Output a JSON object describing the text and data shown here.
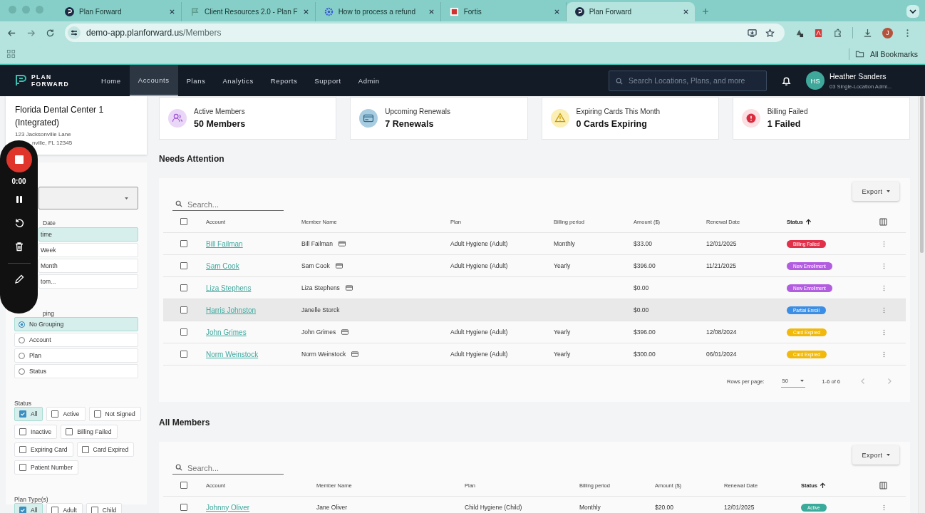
{
  "browser": {
    "tabs": [
      {
        "title": "Plan Forward",
        "kind": "planforward",
        "selected": false
      },
      {
        "title": "Client Resources 2.0 - Plan F",
        "kind": "flag",
        "selected": false
      },
      {
        "title": "How to process a refund",
        "kind": "gear",
        "selected": false
      },
      {
        "title": "Fortis",
        "kind": "fortis",
        "selected": false
      },
      {
        "title": "Plan Forward",
        "kind": "planforward",
        "selected": true
      }
    ],
    "url_host": "demo-app.planforward.us",
    "url_path": "/Members",
    "profile_initial": "J",
    "bookmarks_label": "All Bookmarks"
  },
  "app": {
    "logo_lines": [
      "PLAN",
      "FORWARD"
    ],
    "nav": [
      {
        "label": "Home",
        "selected": false
      },
      {
        "label": "Accounts",
        "selected": true
      },
      {
        "label": "Plans",
        "selected": false
      },
      {
        "label": "Analytics",
        "selected": false
      },
      {
        "label": "Reports",
        "selected": false
      },
      {
        "label": "Support",
        "selected": false
      },
      {
        "label": "Admin",
        "selected": false
      }
    ],
    "search": {
      "placeholder": "Search Locations, Plans, and more"
    },
    "user": {
      "initials": "HS",
      "name": "Heather Sanders",
      "role": "03 Single-Location Admi..."
    }
  },
  "location": {
    "name": "Florida Dental Center 1 (Integrated)",
    "address_1": "123 Jacksonville Lane",
    "address_2": "nville, FL 12345"
  },
  "recorder": {
    "time": "0:00"
  },
  "filters": {
    "date_label": "Date",
    "date_options": [
      {
        "label": "time",
        "selected": true
      },
      {
        "label": "Week",
        "selected": false
      },
      {
        "label": "Month",
        "selected": false
      },
      {
        "label": "tom...",
        "selected": false
      }
    ],
    "grouping_label": "ping",
    "grouping_options": [
      {
        "label": "No Grouping",
        "selected": true
      },
      {
        "label": "Account",
        "selected": false
      },
      {
        "label": "Plan",
        "selected": false
      },
      {
        "label": "Status",
        "selected": false
      }
    ],
    "status_label": "Status",
    "status_chips": [
      {
        "label": "All",
        "checked": true
      },
      {
        "label": "Active",
        "checked": false
      },
      {
        "label": "Not Signed",
        "checked": false
      },
      {
        "label": "Inactive",
        "checked": false
      },
      {
        "label": "Billing Failed",
        "checked": false
      },
      {
        "label": "Expiring Card",
        "checked": false
      },
      {
        "label": "Card Expired",
        "checked": false
      },
      {
        "label": "Patient Number",
        "checked": false
      }
    ],
    "plan_type_label": "Plan Type(s)",
    "plan_type_chips": [
      {
        "label": "All",
        "checked": true
      },
      {
        "label": "Adult",
        "checked": false
      },
      {
        "label": "Child",
        "checked": false
      }
    ]
  },
  "stats": [
    {
      "kind": "members",
      "label": "Active Members",
      "value": "50 Members"
    },
    {
      "kind": "renewals",
      "label": "Upcoming Renewals",
      "value": "7 Renewals"
    },
    {
      "kind": "warning",
      "label": "Expiring Cards This Month",
      "value": "0 Cards Expiring"
    },
    {
      "kind": "error",
      "label": "Billing Failed",
      "value": "1 Failed"
    }
  ],
  "sections": [
    {
      "title": "Needs Attention",
      "search": {
        "placeholder": "Search..."
      },
      "export": "Export",
      "all_checked": false,
      "columns": [
        {
          "label": "Account",
          "sorted": false
        },
        {
          "label": "Member Name",
          "sorted": false
        },
        {
          "label": "Plan",
          "sorted": false
        },
        {
          "label": "Billing period",
          "sorted": false
        },
        {
          "label": "Amount ($)",
          "sorted": false
        },
        {
          "label": "Renewal Date",
          "sorted": false
        },
        {
          "label": "Status",
          "sorted": true
        }
      ],
      "rows": [
        {
          "account": "Bill Failman",
          "member": "Bill Failman",
          "card_on_file": true,
          "plan": "Adult Hygiene (Adult)",
          "billing": "Monthly",
          "amount": "$33.00",
          "renewal": "12/01/2025",
          "status": "Billing Failed",
          "color": "#e0304a",
          "checked": false,
          "highlighted": false
        },
        {
          "account": "Sam Cook",
          "member": "Sam Cook",
          "card_on_file": true,
          "plan": "Adult Hygiene (Adult)",
          "billing": "Yearly",
          "amount": "$396.00",
          "renewal": "11/21/2025",
          "status": "New Enrollment",
          "color": "#b25ce0",
          "checked": false,
          "highlighted": false
        },
        {
          "account": "Liza Stephens",
          "member": "Liza Stephens",
          "card_on_file": true,
          "plan": "",
          "billing": "",
          "amount": "$0.00",
          "renewal": "",
          "status": "New Enrollment",
          "color": "#b25ce0",
          "checked": false,
          "highlighted": false
        },
        {
          "account": "Harris Johnston",
          "member": "Janelle Storck",
          "card_on_file": false,
          "plan": "",
          "billing": "",
          "amount": "$0.00",
          "renewal": "",
          "status": "Partial Enroll",
          "color": "#3a8ee6",
          "checked": false,
          "highlighted": true
        },
        {
          "account": "John Grimes",
          "member": "John Grimes",
          "card_on_file": true,
          "plan": "Adult Hygiene (Adult)",
          "billing": "Yearly",
          "amount": "$396.00",
          "renewal": "12/08/2024",
          "status": "Card Expired",
          "color": "#f0b90b",
          "checked": false,
          "highlighted": false
        },
        {
          "account": "Norm Weinstock",
          "member": "Norm Weinstock",
          "card_on_file": true,
          "plan": "Adult Hygiene (Adult)",
          "billing": "Yearly",
          "amount": "$300.00",
          "renewal": "06/01/2024",
          "status": "Card Expired",
          "color": "#f0b90b",
          "checked": false,
          "highlighted": false
        }
      ],
      "pagination": {
        "rows_per_page_label": "Rows per page:",
        "rows_per_page": "50",
        "range": "1-6 of 6"
      }
    },
    {
      "title": "All Members",
      "search": {
        "placeholder": "Search..."
      },
      "export": "Export",
      "all_checked": false,
      "columns": [
        {
          "label": "Account",
          "sorted": false
        },
        {
          "label": "Member Name",
          "sorted": false
        },
        {
          "label": "Plan",
          "sorted": false
        },
        {
          "label": "Billing period",
          "sorted": false
        },
        {
          "label": "Amount ($)",
          "sorted": false
        },
        {
          "label": "Renewal Date",
          "sorted": false
        },
        {
          "label": "Status",
          "sorted": true
        }
      ],
      "rows": [
        {
          "account": "Johnny Oliver",
          "member": "Jane Oliver",
          "card_on_file": false,
          "plan": "Child Hygiene (Child)",
          "billing": "Monthly",
          "amount": "$20.00",
          "renewal": "12/01/2025",
          "status": "Active",
          "color": "#3aaa9a",
          "checked": false,
          "highlighted": false
        }
      ]
    }
  ]
}
